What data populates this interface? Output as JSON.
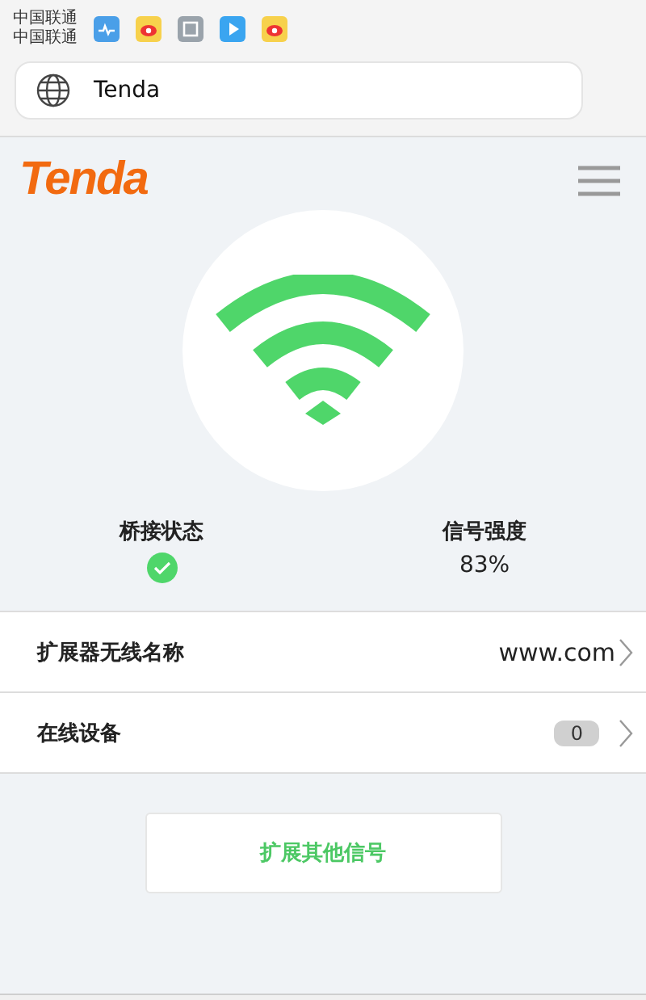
{
  "status_bar": {
    "carriers": [
      "中国联通",
      "中国联通"
    ]
  },
  "address_bar": {
    "title": "Tenda"
  },
  "header": {
    "logo": "Tenda"
  },
  "status": [
    {
      "kind": "check",
      "label": "桥接状态",
      "ok": true
    },
    {
      "kind": "text",
      "label": "信号强度",
      "value": "83%"
    }
  ],
  "rows": [
    {
      "kind": "value",
      "label": "扩展器无线名称",
      "value": "www.com"
    },
    {
      "kind": "badge",
      "label": "在线设备",
      "value": "0"
    }
  ],
  "button": "扩展其他信号"
}
